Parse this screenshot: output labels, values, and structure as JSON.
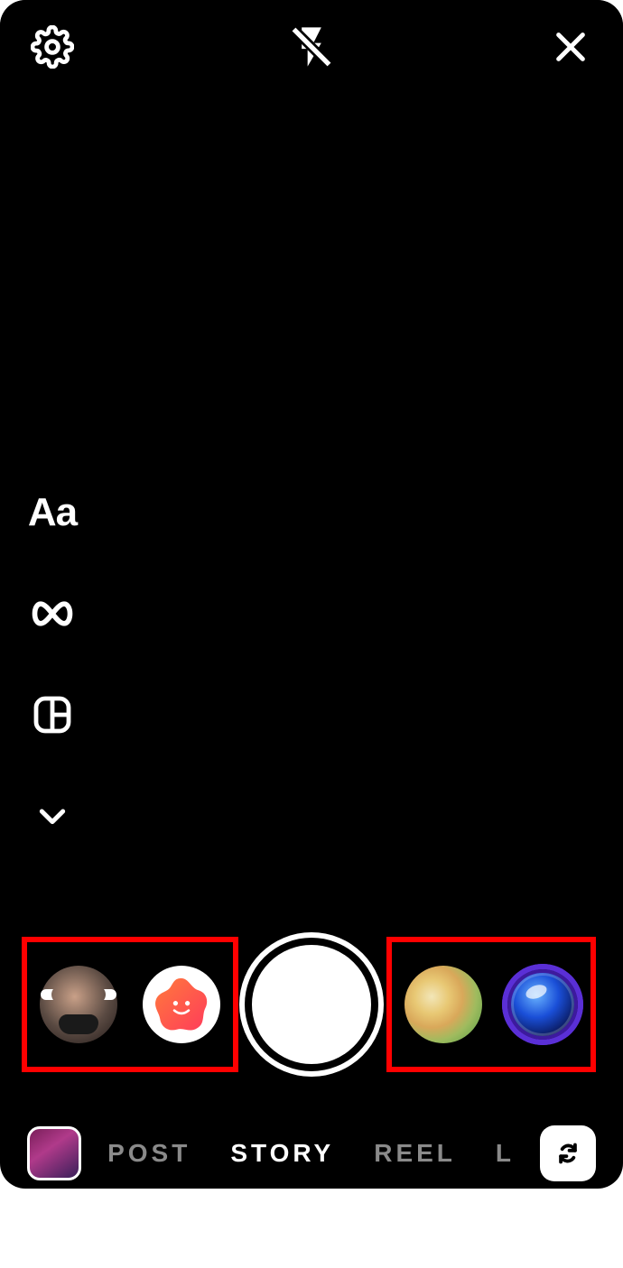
{
  "top": {
    "settings_icon": "gear-icon",
    "flash_icon": "flash-off-icon",
    "close_icon": "close-icon"
  },
  "side_tools": {
    "text_label": "Aa",
    "boomerang_icon": "infinity-icon",
    "layout_icon": "layout-icon",
    "expand_icon": "chevron-down-icon"
  },
  "filters": {
    "left": [
      {
        "name": "face-mask-filter"
      },
      {
        "name": "star-smile-filter"
      }
    ],
    "right": [
      {
        "name": "gradient-orb-filter"
      },
      {
        "name": "camera-lens-filter"
      }
    ]
  },
  "shutter_label": "capture",
  "modes": {
    "items": [
      "POST",
      "STORY",
      "REEL",
      "LIVE"
    ],
    "active_index": 1
  },
  "bottom": {
    "gallery_icon": "gallery-thumb",
    "switch_icon": "switch-camera-icon"
  }
}
